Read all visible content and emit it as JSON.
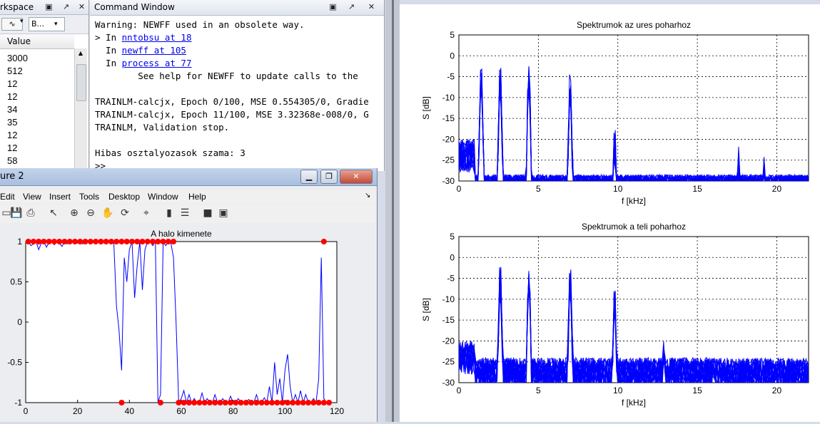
{
  "workspace": {
    "title": "rkspace",
    "dropdown_label": "B...",
    "column_header": "Value",
    "values": [
      "3000",
      "512",
      "12",
      "12",
      "34",
      "35",
      "12",
      "12",
      "58"
    ]
  },
  "command_window": {
    "title": "Command Window",
    "lines": [
      {
        "text": "Warning: NEWFF used in an obsolete way."
      },
      {
        "prefix": "> In ",
        "link": "nntobsu at 18"
      },
      {
        "prefix": "  In ",
        "link": "newff at 105"
      },
      {
        "prefix": "  In ",
        "link": "process at 77"
      },
      {
        "text": "        See help for NEWFF to update calls to the"
      },
      {
        "text": ""
      },
      {
        "text": "TRAINLM-calcjx, Epoch 0/100, MSE 0.554305/0, Gradie"
      },
      {
        "text": "TRAINLM-calcjx, Epoch 11/100, MSE 3.32368e-008/0, G"
      },
      {
        "text": "TRAINLM, Validation stop."
      },
      {
        "text": ""
      },
      {
        "text": "Hibas osztalyozasok szama: 3"
      },
      {
        "text": ">>"
      }
    ]
  },
  "figure2": {
    "title": "ure 2",
    "menu": [
      "Edit",
      "View",
      "Insert",
      "Tools",
      "Desktop",
      "Window",
      "Help"
    ],
    "toolbar_icons": [
      "save-icon",
      "print-icon",
      "pointer-icon",
      "zoom-in-icon",
      "zoom-out-icon",
      "pan-icon",
      "rotate-icon",
      "data-cursor-icon",
      "colorbar-icon",
      "legend-icon",
      "hide-plot-tools-icon",
      "show-plot-tools-icon"
    ]
  },
  "chart_data": [
    {
      "type": "line",
      "title": "A halo kimenete",
      "xlabel": "",
      "ylabel": "",
      "xlim": [
        0,
        120
      ],
      "ylim": [
        -1,
        1
      ],
      "xticks": [
        0,
        20,
        40,
        60,
        80,
        100,
        120
      ],
      "yticks": [
        -1,
        -0.5,
        0,
        0.5,
        1
      ],
      "ytick_labels": [
        "-1",
        "-0.5",
        "0",
        "0.5",
        "1"
      ],
      "grid": false,
      "colors": {
        "line": "#0000ff",
        "markers": "#ff0000"
      },
      "series": [
        {
          "style": "line",
          "x": [
            1,
            2,
            3,
            4,
            5,
            6,
            7,
            8,
            9,
            10,
            11,
            12,
            13,
            14,
            15,
            16,
            17,
            18,
            19,
            20,
            21,
            22,
            23,
            24,
            25,
            26,
            27,
            28,
            29,
            30,
            31,
            32,
            33,
            34,
            35,
            36,
            37,
            38,
            39,
            40,
            41,
            42,
            43,
            44,
            45,
            46,
            47,
            48,
            49,
            50,
            51,
            52,
            53,
            54,
            55,
            56,
            57,
            58,
            59,
            60,
            61,
            62,
            63,
            64,
            65,
            66,
            67,
            68,
            69,
            70,
            71,
            72,
            73,
            74,
            75,
            76,
            77,
            78,
            79,
            80,
            81,
            82,
            83,
            84,
            85,
            86,
            87,
            88,
            89,
            90,
            91,
            92,
            93,
            94,
            95,
            96,
            97,
            98,
            99,
            100,
            101,
            102,
            103,
            104,
            105,
            106,
            107,
            108,
            109,
            110,
            111,
            112,
            113,
            114,
            115,
            116,
            117
          ],
          "y": [
            1,
            0.95,
            0.97,
            1,
            0.9,
            0.98,
            1,
            0.93,
            0.99,
            1,
            0.96,
            1,
            0.98,
            0.94,
            1,
            0.97,
            1,
            0.99,
            1,
            0.98,
            1,
            0.97,
            1,
            1,
            1,
            0.99,
            1,
            1,
            1,
            1,
            1,
            1,
            1,
            0.98,
            0.2,
            -0.1,
            -0.6,
            0.8,
            0.5,
            0.9,
            1,
            0.3,
            0.7,
            1,
            0.4,
            0.9,
            1,
            1,
            0.95,
            1,
            -1,
            -0.9,
            1,
            0.95,
            1,
            0.98,
            0.8,
            0,
            -1,
            -0.95,
            -0.85,
            -1,
            -0.9,
            -1,
            -0.95,
            -1,
            -1,
            -0.88,
            -1,
            -0.95,
            -1,
            -1,
            -0.9,
            -1,
            -1,
            -0.95,
            -1,
            -1,
            -0.92,
            -1,
            -1,
            -0.95,
            -1,
            -1,
            -1,
            -0.96,
            -1,
            -1,
            -0.9,
            -1,
            -1,
            -0.94,
            -1,
            -0.8,
            -1,
            -0.5,
            -0.9,
            -0.7,
            -1,
            -0.6,
            -0.4,
            -0.8,
            -1,
            -0.9,
            -1,
            -0.85,
            -1,
            -0.9,
            -1,
            -1,
            -0.95,
            -1,
            -0.7,
            0.8,
            -0.95,
            -1,
            -1
          ]
        },
        {
          "style": "markers",
          "x": [
            1,
            3,
            5,
            7,
            9,
            11,
            13,
            15,
            17,
            19,
            21,
            23,
            25,
            27,
            29,
            31,
            33,
            35,
            37,
            39,
            41,
            43,
            45,
            47,
            49,
            51,
            53,
            55,
            57,
            59,
            61,
            63,
            65,
            67,
            69,
            71,
            73,
            75,
            77,
            79,
            81,
            83,
            85,
            87,
            89,
            91,
            93,
            95,
            97,
            99,
            101,
            103,
            105,
            107,
            109,
            111,
            113,
            115,
            117
          ],
          "y": [
            1,
            1,
            1,
            1,
            1,
            1,
            1,
            1,
            1,
            1,
            1,
            1,
            1,
            1,
            1,
            1,
            1,
            1,
            1,
            1,
            1,
            1,
            1,
            1,
            1,
            1,
            1,
            1,
            1,
            -1,
            -1,
            -1,
            -1,
            -1,
            -1,
            -1,
            -1,
            -1,
            -1,
            -1,
            -1,
            -1,
            -1,
            -1,
            -1,
            -1,
            -1,
            -1,
            -1,
            -1,
            -1,
            -1,
            -1,
            -1,
            -1,
            -1,
            -1,
            -1,
            -1
          ]
        },
        {
          "style": "markers",
          "x": [
            37,
            52,
            115
          ],
          "y": [
            -1,
            -1,
            1
          ]
        }
      ]
    },
    {
      "type": "line",
      "title": "Spektrumok az ures poharhoz",
      "xlabel": "f [kHz]",
      "ylabel": "S [dB]",
      "xlim": [
        0,
        22
      ],
      "ylim": [
        -30,
        5
      ],
      "xticks": [
        0,
        5,
        10,
        15,
        20
      ],
      "yticks": [
        -30,
        -25,
        -20,
        -15,
        -10,
        -5,
        0,
        5
      ],
      "grid": true,
      "peaks": [
        {
          "f": 1.4,
          "db": 0
        },
        {
          "f": 2.6,
          "db": 0
        },
        {
          "f": 4.4,
          "db": 0
        },
        {
          "f": 7.0,
          "db": -2
        },
        {
          "f": 9.8,
          "db": -15
        },
        {
          "f": 17.6,
          "db": -20
        },
        {
          "f": 19.2,
          "db": -22
        },
        {
          "f": 12.9,
          "db": -29
        },
        {
          "f": 16.9,
          "db": -27
        },
        {
          "f": 20.7,
          "db": -28
        }
      ],
      "noise_floor_db": -29
    },
    {
      "type": "line",
      "title": "Spektrumok a teli poharhoz",
      "xlabel": "f [kHz]",
      "ylabel": "S [dB]",
      "xlim": [
        0,
        22
      ],
      "ylim": [
        -30,
        5
      ],
      "xticks": [
        0,
        5,
        10,
        15,
        20
      ],
      "yticks": [
        -30,
        -25,
        -20,
        -15,
        -10,
        -5,
        0,
        5
      ],
      "grid": true,
      "peaks": [
        {
          "f": 2.6,
          "db": 0
        },
        {
          "f": 4.4,
          "db": 0
        },
        {
          "f": 7.0,
          "db": 0
        },
        {
          "f": 9.8,
          "db": -4
        },
        {
          "f": 12.9,
          "db": -17
        },
        {
          "f": 16.0,
          "db": -22
        },
        {
          "f": 18.5,
          "db": -27
        },
        {
          "f": 20.0,
          "db": -26
        },
        {
          "f": 21.0,
          "db": -27
        }
      ],
      "noise_floor_db": -27
    }
  ]
}
